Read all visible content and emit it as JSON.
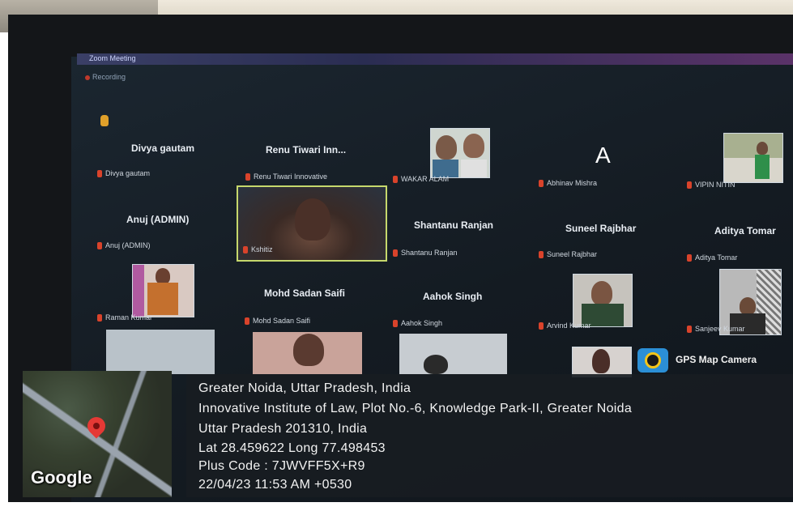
{
  "window": {
    "title": "Zoom Meeting",
    "recording_label": "Recording"
  },
  "participants": [
    {
      "name": "Divya gautam",
      "label": "Divya gautam"
    },
    {
      "name": "Renu Tiwari Inn...",
      "label": "Renu Tiwari Innovative"
    },
    {
      "name": "",
      "label": "WAKAR ALAM"
    },
    {
      "name": "A",
      "label": "Abhinav Mishra"
    },
    {
      "name": "",
      "label": "VIPIN NITIN"
    },
    {
      "name": "Anuj (ADMIN)",
      "label": "Anuj (ADMIN)"
    },
    {
      "name": "",
      "label": "Kshitiz"
    },
    {
      "name": "Shantanu Ranjan",
      "label": "Shantanu Ranjan"
    },
    {
      "name": "Suneel Rajbhar",
      "label": "Suneel Rajbhar"
    },
    {
      "name": "Aditya Tomar",
      "label": "Aditya Tomar"
    },
    {
      "name": "",
      "label": "Raman Kumar"
    },
    {
      "name": "Mohd Sadan Saifi",
      "label": "Mohd Sadan Saifi"
    },
    {
      "name": "Aahok Singh",
      "label": "Aahok Singh"
    },
    {
      "name": "",
      "label": "Arvind Kumar"
    },
    {
      "name": "",
      "label": "Sanjeev Kumar"
    }
  ],
  "gps": {
    "app_name": "GPS Map Camera",
    "lines": [
      "Greater Noida, Uttar Pradesh, India",
      "Innovative Institute of Law, Plot No.-6, Knowledge Park-II, Greater Noida",
      "Uttar Pradesh 201310, India",
      "Lat 28.459622 Long 77.498453",
      "Plus Code : 7JWVFF5X+R9",
      "22/04/23 11:53 AM +0530"
    ],
    "map_brand": "Google"
  },
  "icons": [
    "mic-muted-icon",
    "map-pin-icon",
    "gps-camera-icon",
    "raise-hand-icon"
  ],
  "colors": {
    "active_speaker": "#c6d86c",
    "muted_mic": "#d9432b",
    "overlay_bg": "#181c22"
  }
}
